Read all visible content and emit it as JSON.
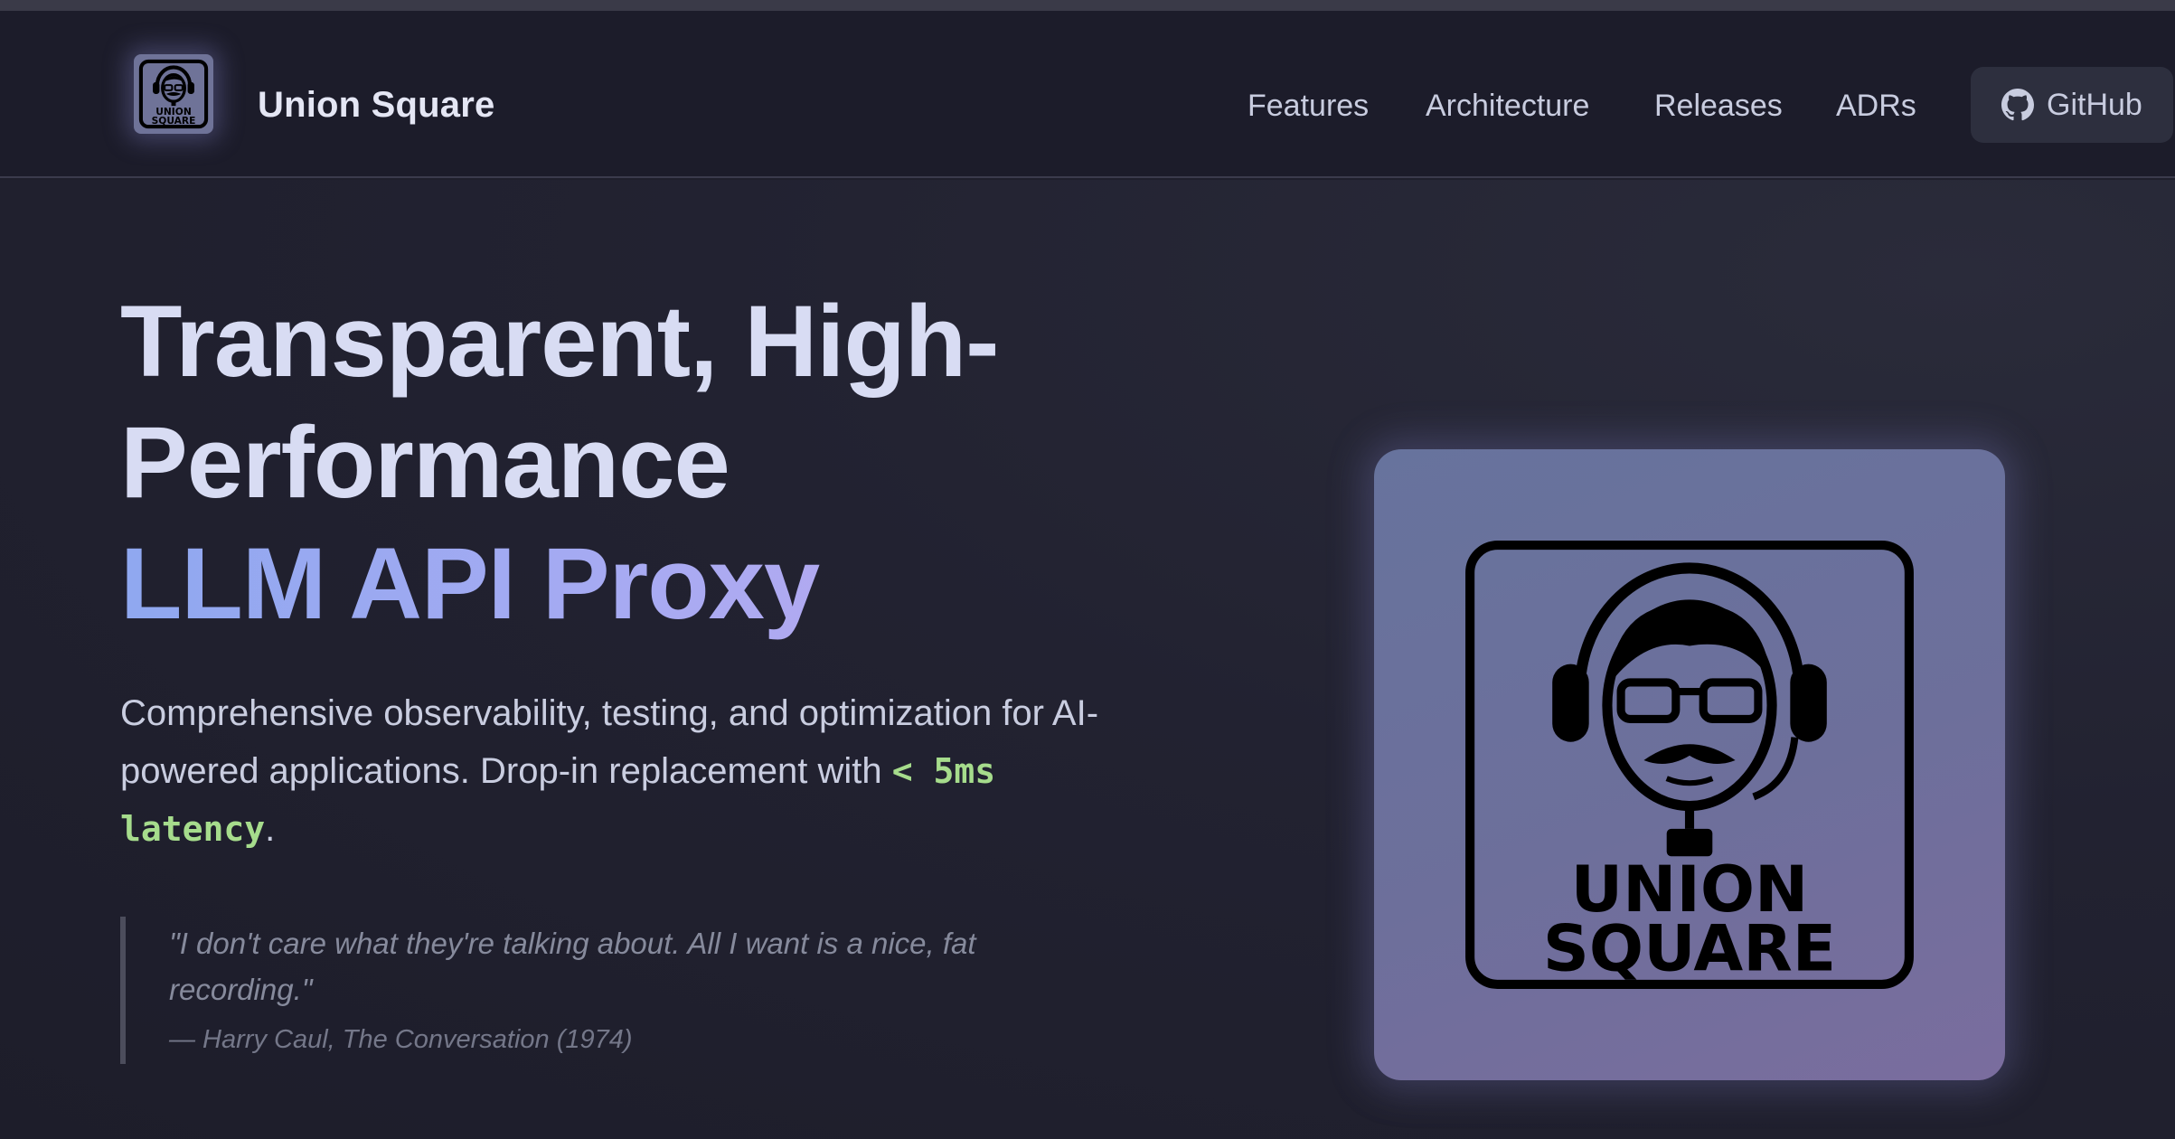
{
  "brand": {
    "name": "Union Square",
    "logo_text_line1": "UNION",
    "logo_text_line2": "SQUARE"
  },
  "nav": {
    "links": [
      {
        "label": "Features"
      },
      {
        "label": "Architecture"
      },
      {
        "label": "Releases"
      },
      {
        "label": "ADRs"
      }
    ],
    "github_label": "GitHub",
    "github_icon": "github-icon"
  },
  "hero": {
    "title_line1": "Transparent, High-",
    "title_line2": "Performance",
    "title_line3": "LLM API Proxy",
    "subtitle_part1": "Comprehensive observability, testing, and optimization for AI-powered applications. Drop-in replacement with ",
    "subtitle_code": "< 5ms latency",
    "subtitle_end": ".",
    "quote_text": "\"I don't care what they're talking about. All I want is a nice, fat recording.\"",
    "quote_cite": "— Harry Caul, The Conversation (1974)"
  },
  "colors": {
    "background": "#1f1f2c",
    "accent_gradient_start": "#8fa8f0",
    "accent_gradient_end": "#c3a8ee",
    "code_green": "#a6dc8c"
  }
}
